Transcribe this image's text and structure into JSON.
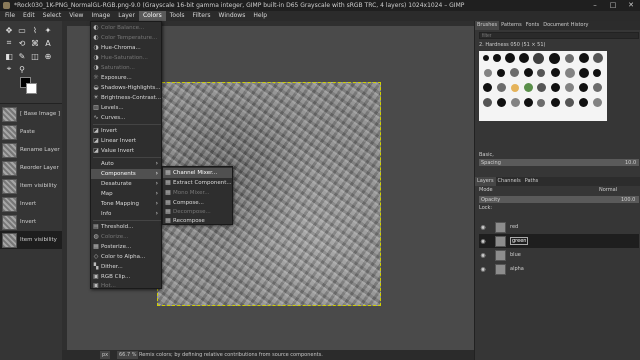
{
  "window": {
    "title": "*Rock030_1K-PNG_NormalGL-RGB.png-9.0 (Grayscale 16-bit gamma integer, GIMP built-in D65 Grayscale with sRGB TRC, 4 layers) 1024x1024 – GIMP",
    "minimize": "–",
    "maximize": "□",
    "close": "✕"
  },
  "menubar": [
    "File",
    "Edit",
    "Select",
    "View",
    "Image",
    "Layer",
    "Colors",
    "Tools",
    "Filters",
    "Windows",
    "Help"
  ],
  "undo_history": [
    {
      "label": "[ Base Image ]"
    },
    {
      "label": "Paste"
    },
    {
      "label": "Rename Layer"
    },
    {
      "label": "Reorder Layer"
    },
    {
      "label": "Item visibility"
    },
    {
      "label": "Invert"
    },
    {
      "label": "Invert"
    },
    {
      "label": "Item visibility"
    }
  ],
  "colors_menu": {
    "items": [
      {
        "label": "Color Balance...",
        "disabled": true
      },
      {
        "label": "Color Temperature...",
        "disabled": true
      },
      {
        "label": "Hue-Chroma...",
        "disabled": false
      },
      {
        "label": "Hue-Saturation...",
        "disabled": true
      },
      {
        "label": "Saturation...",
        "disabled": true
      },
      {
        "label": "Exposure...",
        "disabled": false
      },
      {
        "label": "Shadows-Highlights...",
        "disabled": false
      },
      {
        "label": "Brightness-Contrast...",
        "disabled": false
      },
      {
        "label": "Levels...",
        "disabled": false
      },
      {
        "label": "Curves...",
        "disabled": false
      },
      {
        "label": "Invert",
        "disabled": false
      },
      {
        "label": "Linear Invert",
        "disabled": false
      },
      {
        "label": "Value Invert",
        "disabled": false
      },
      {
        "label": "Auto",
        "disabled": false
      },
      {
        "label": "Components",
        "disabled": false
      },
      {
        "label": "Desaturate",
        "disabled": false
      },
      {
        "label": "Map",
        "disabled": false
      },
      {
        "label": "Tone Mapping",
        "disabled": false
      },
      {
        "label": "Info",
        "disabled": false
      },
      {
        "label": "Threshold...",
        "disabled": false
      },
      {
        "label": "Colorize...",
        "disabled": true
      },
      {
        "label": "Posterize...",
        "disabled": false
      },
      {
        "label": "Color to Alpha...",
        "disabled": false
      },
      {
        "label": "Dither...",
        "disabled": false
      },
      {
        "label": "RGB Clip...",
        "disabled": false
      },
      {
        "label": "Hot...",
        "disabled": true
      }
    ]
  },
  "components_submenu": [
    {
      "label": "Channel Mixer...",
      "disabled": false
    },
    {
      "label": "Extract Component...",
      "disabled": false
    },
    {
      "label": "Mono Mixer...",
      "disabled": true
    },
    {
      "label": "Compose...",
      "disabled": false
    },
    {
      "label": "Decompose...",
      "disabled": true
    },
    {
      "label": "Recompose",
      "disabled": false
    }
  ],
  "statusbar": {
    "unit": "px",
    "zoom": "66.7 %",
    "message": "Remix colors; by defining relative contributions from source components."
  },
  "brushes_panel": {
    "tabs": [
      "Brushes",
      "Patterns",
      "Fonts",
      "Document History"
    ],
    "filter_placeholder": "filter",
    "brush_name": "2. Hardness 050 (51 × 51)",
    "preset": "Basic,",
    "spacing_label": "Spacing",
    "spacing_value": "10.0"
  },
  "layers_panel": {
    "tabs": [
      "Layers",
      "Channels",
      "Paths"
    ],
    "mode_label": "Mode",
    "mode_value": "Normal",
    "opacity_label": "Opacity",
    "opacity_value": "100.0",
    "lock_label": "Lock:",
    "layers": [
      {
        "name": "red",
        "visible": true
      },
      {
        "name": "green",
        "visible": true
      },
      {
        "name": "blue",
        "visible": true
      },
      {
        "name": "alpha",
        "visible": true
      }
    ]
  }
}
